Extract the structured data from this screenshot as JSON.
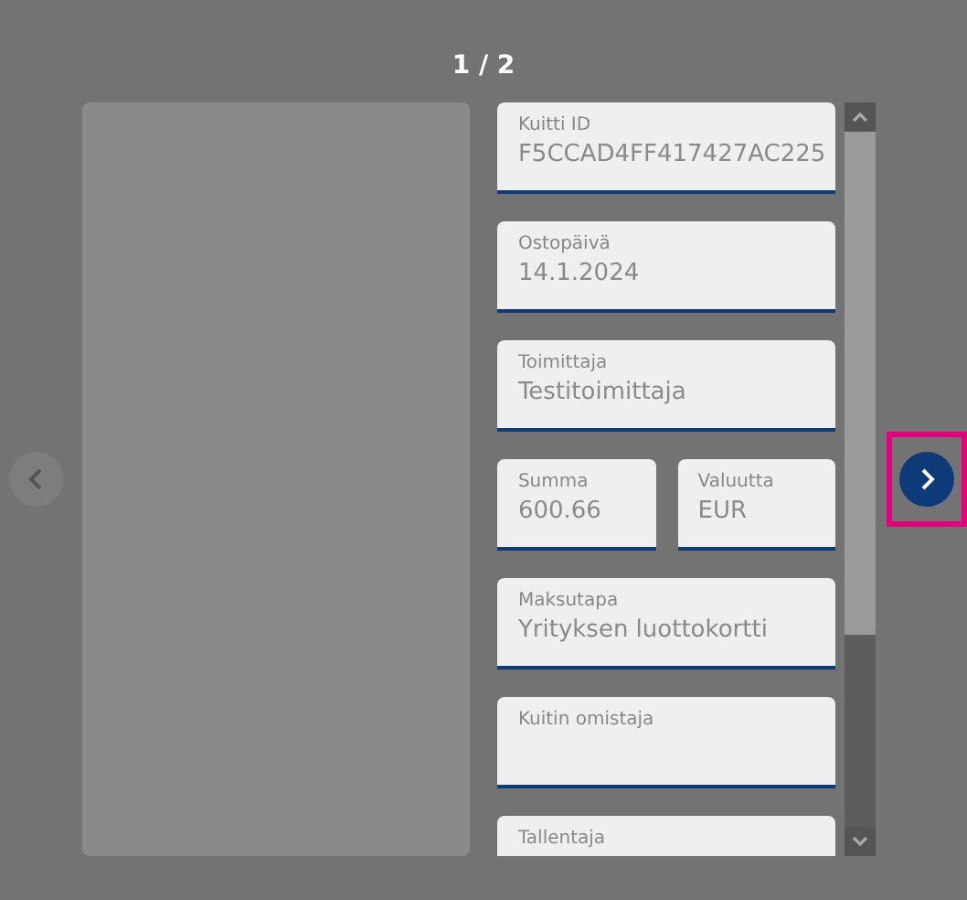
{
  "pager": {
    "counter": "1 / 2",
    "prev": {
      "disabled": true
    },
    "next": {
      "disabled": false,
      "highlighted": true
    }
  },
  "form_rows": [
    [
      {
        "label": "Kuitti ID",
        "value": "F5CCAD4FF417427AC225"
      }
    ],
    [
      {
        "label": "Ostopäivä",
        "value": "14.1.2024"
      }
    ],
    [
      {
        "label": "Toimittaja",
        "value": "Testitoimittaja"
      }
    ],
    [
      {
        "label": "Summa",
        "value": "600.66"
      },
      {
        "label": "Valuutta",
        "value": "EUR"
      }
    ],
    [
      {
        "label": "Maksutapa",
        "value": "Yrityksen luottokortti"
      }
    ],
    [
      {
        "label": "Kuitin omistaja"
      }
    ],
    [
      {
        "label": "Tallentaja"
      }
    ]
  ]
}
